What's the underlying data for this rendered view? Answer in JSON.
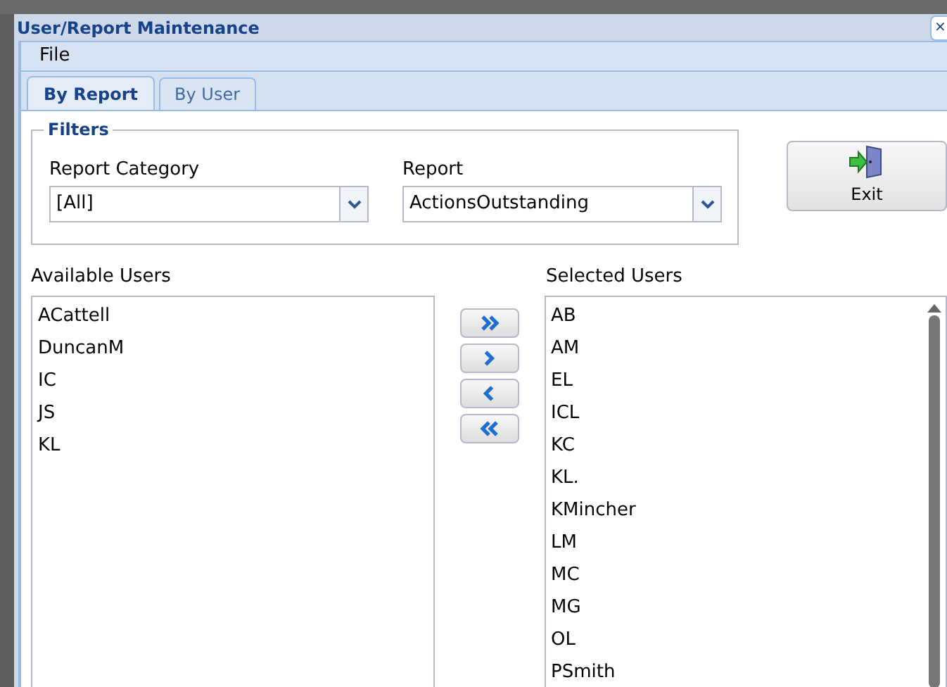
{
  "window": {
    "title": "User/Report Maintenance",
    "close_icon": "×"
  },
  "menu": [
    "File"
  ],
  "tabs": [
    {
      "label": "By Report",
      "selected": true
    },
    {
      "label": "By User",
      "selected": false
    }
  ],
  "filters": {
    "legend": "Filters",
    "report_category": {
      "label": "Report Category",
      "value": "[All]"
    },
    "report": {
      "label": "Report",
      "value": "ActionsOutstanding"
    }
  },
  "exit_button": "Exit",
  "available_users": {
    "label": "Available Users",
    "items": [
      "ACattell",
      "DuncanM",
      "IC",
      "JS",
      "KL"
    ]
  },
  "move_buttons": [
    {
      "kind": "add-all"
    },
    {
      "kind": "add"
    },
    {
      "kind": "remove"
    },
    {
      "kind": "remove-all"
    }
  ],
  "selected_users": {
    "label": "Selected Users",
    "items": [
      "AB",
      "AM",
      "EL",
      "ICL",
      "KC",
      "KL.",
      "KMincher",
      "LM",
      "MC",
      "MG",
      "OL",
      "PSmith"
    ]
  }
}
